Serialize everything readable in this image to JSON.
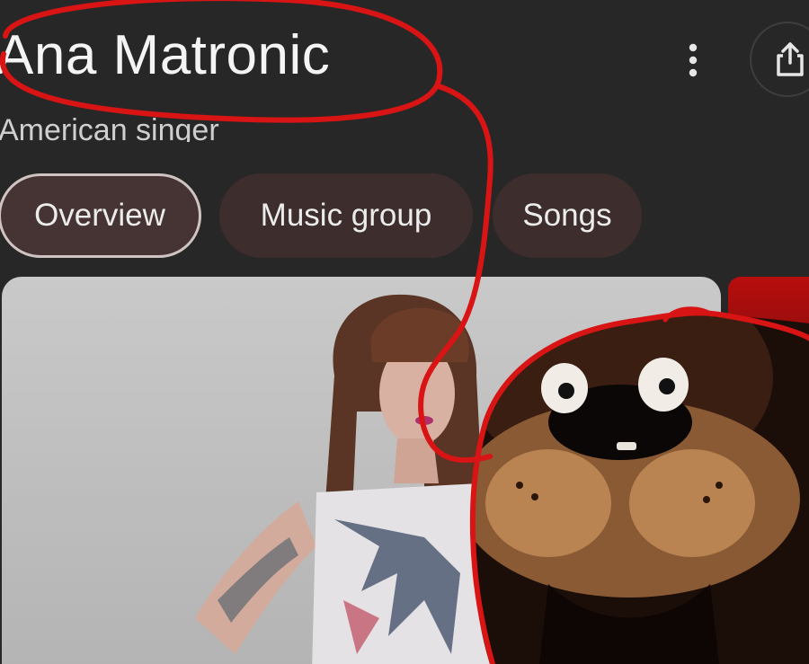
{
  "header": {
    "title": "Ana Matronic",
    "subtitle": "American singer"
  },
  "actions": {
    "more_icon": "more-vert-icon",
    "share_icon": "share-icon"
  },
  "tabs": [
    {
      "label": "Overview",
      "selected": true
    },
    {
      "label": "Music group",
      "selected": false
    },
    {
      "label": "Songs",
      "selected": false
    }
  ],
  "colors": {
    "background": "#282727",
    "chip_selected_bg": "#453433",
    "chip_bg": "#3d2e2d",
    "annotation_red": "#d81414"
  }
}
